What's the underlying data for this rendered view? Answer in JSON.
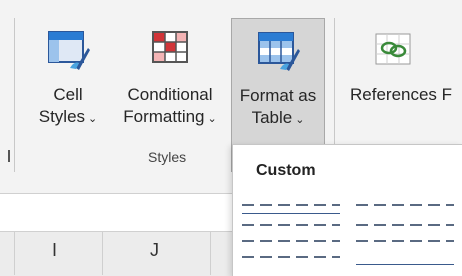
{
  "ribbon": {
    "buttons": [
      {
        "label_line1": "Cell",
        "label_line2": "Styles",
        "icon": "cell-styles-icon"
      },
      {
        "label_line1": "Conditional",
        "label_line2": "Formatting",
        "icon": "conditional-formatting-icon"
      },
      {
        "label_line1": "Format as",
        "label_line2": "Table",
        "icon": "format-as-table-icon"
      },
      {
        "label_line1": "References",
        "label_line2": "",
        "icon": "references-icon"
      }
    ],
    "truncated_next": "F",
    "group_label": "Styles"
  },
  "sheet": {
    "column_headers": [
      "I",
      "J"
    ]
  },
  "dropdown": {
    "section_label": "Custom"
  },
  "colors": {
    "ribbon_bg": "#f3f3f3",
    "active_button_bg": "#d6d6d6",
    "accent_blue": "#2b7cd3",
    "accent_red": "#d13438",
    "accent_green": "#3a8a3a"
  }
}
